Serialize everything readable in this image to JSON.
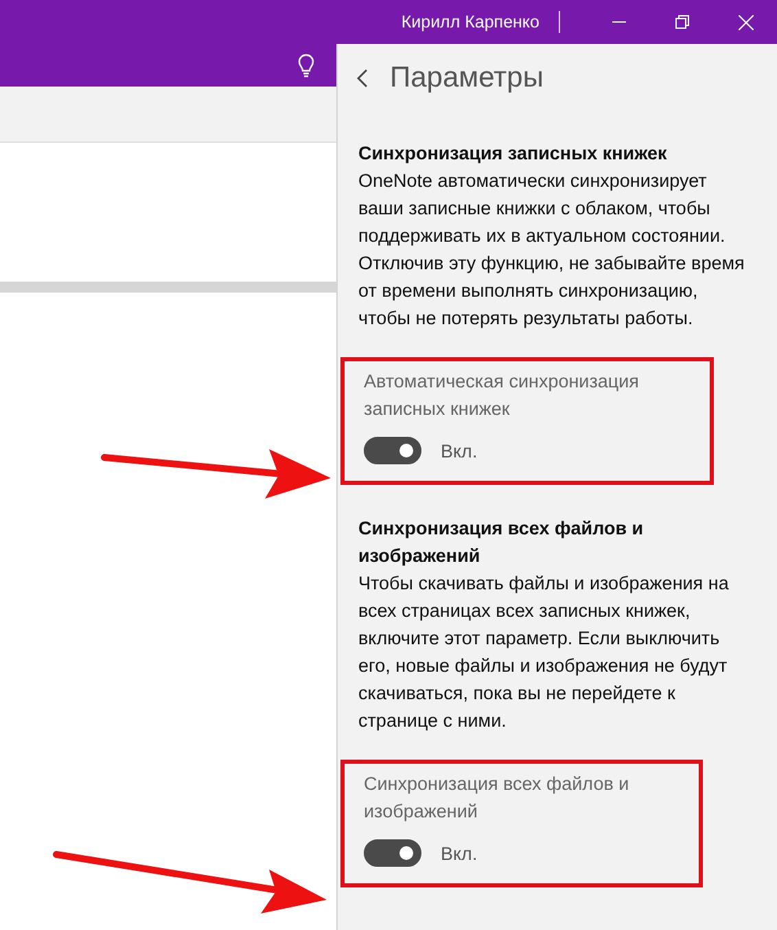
{
  "window": {
    "user_name": "Кирилл Карпенко"
  },
  "panel": {
    "title": "Параметры",
    "sections": [
      {
        "heading": "Синхронизация записных книжек",
        "description": "OneNote автоматически синхронизирует ваши записные книжки с облаком, чтобы поддерживать их в актуальном состоянии. Отключив эту функцию, не забывайте время от времени выполнять синхронизацию, чтобы не потерять результаты работы.",
        "setting": {
          "label": "Автоматическая синхронизация записных книжек",
          "on": true,
          "state_text": "Вкл.",
          "highlighted": true
        }
      },
      {
        "heading": "Синхронизация всех файлов и изображений",
        "description": "Чтобы скачивать файлы и изображения на всех страницах всех записных книжек, включите этот параметр. Если выключить его, новые файлы и изображения не будут скачиваться, пока вы не перейдете к странице с ними.",
        "setting": {
          "label": "Синхронизация всех файлов и изображений",
          "on": true,
          "state_text": "Вкл.",
          "highlighted": true
        }
      }
    ]
  }
}
